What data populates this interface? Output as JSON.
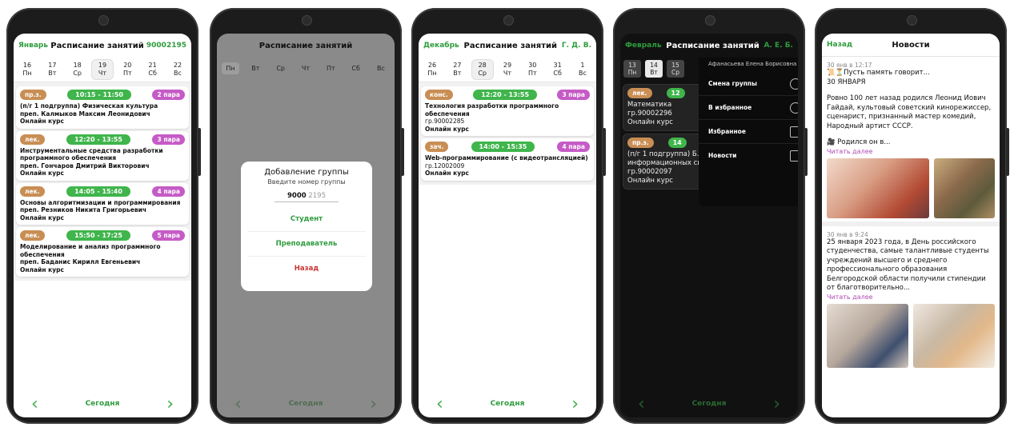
{
  "phone1": {
    "month": "Январь",
    "title": "Расписание занятий",
    "group": "90002195",
    "days": [
      {
        "num": "16",
        "dow": "Пн"
      },
      {
        "num": "17",
        "dow": "Вт"
      },
      {
        "num": "18",
        "dow": "Ср"
      },
      {
        "num": "19",
        "dow": "Чт"
      },
      {
        "num": "20",
        "dow": "Пт"
      },
      {
        "num": "21",
        "dow": "Сб"
      },
      {
        "num": "22",
        "dow": "Вс"
      }
    ],
    "lessons": [
      {
        "type": "пр.з.",
        "time": "10:15 - 11:50",
        "pair": "2 пара",
        "lines": [
          "(п/г 1 подгруппа)  Физическая культура",
          "преп. Калмыков Максим Леонидович",
          "Онлайн курс"
        ]
      },
      {
        "type": "лек.",
        "time": "12:20 - 13:55",
        "pair": "3 пара",
        "lines": [
          "Инструментальные средства разработки программного обеспечения",
          "преп. Гончаров Дмитрий Викторович",
          "Онлайн курс"
        ]
      },
      {
        "type": "лек.",
        "time": "14:05 - 15:40",
        "pair": "4 пара",
        "lines": [
          "Основы алгоритмизации и программирования",
          "преп. Резников Никита Григорьевич",
          "Онлайн курс"
        ]
      },
      {
        "type": "лек.",
        "time": "15:50 - 17:25",
        "pair": "5 пара",
        "lines": [
          "Моделирование и анализ программного обеспечения",
          "преп. Баданис Кирилл Евгеньевич",
          "Онлайн курс"
        ]
      }
    ],
    "today": "Сегодня"
  },
  "phone2": {
    "title": "Расписание занятий",
    "days": [
      "Пн",
      "Вт",
      "Ср",
      "Чт",
      "Пт",
      "Сб",
      "Вс"
    ],
    "dialog": {
      "title": "Добавление группы",
      "subtitle": "Введите номер группы",
      "typed": "9000",
      "hint": "2195",
      "student": "Студент",
      "teacher": "Преподаватель",
      "back": "Назад"
    },
    "today": "Сегодня"
  },
  "phone3": {
    "month": "Декабрь",
    "title": "Расписание занятий",
    "who": "Г. Д. В.",
    "days": [
      {
        "num": "26",
        "dow": "Пн"
      },
      {
        "num": "27",
        "dow": "Вт"
      },
      {
        "num": "28",
        "dow": "Ср"
      },
      {
        "num": "29",
        "dow": "Чт"
      },
      {
        "num": "30",
        "dow": "Пт"
      },
      {
        "num": "31",
        "dow": "Сб"
      },
      {
        "num": "1",
        "dow": "Вс"
      }
    ],
    "lessons": [
      {
        "type": "конс.",
        "time": "12:20 - 13:55",
        "pair": "3 пара",
        "lines": [
          "Технология разработки программного обеспечения",
          "гр.90002285",
          "Онлайн курс"
        ]
      },
      {
        "type": "зач.",
        "time": "14:00 - 15:35",
        "pair": "4 пара",
        "lines": [
          "Web-программирование (с видеотрансляцией)",
          "гр.12002009",
          "Онлайн курс"
        ]
      }
    ],
    "today": "Сегодня"
  },
  "phone4": {
    "month": "Февраль",
    "title": "Расписание занятий",
    "who": "А. Е. Б.",
    "days": [
      {
        "num": "13",
        "dow": "Пн"
      },
      {
        "num": "14",
        "dow": "Вт"
      },
      {
        "num": "15",
        "dow": "Ср"
      }
    ],
    "cards": [
      {
        "type": "лек.",
        "time": "12",
        "lines": [
          "Математика",
          "гр.90002296",
          "Онлайн курс"
        ]
      },
      {
        "type": "пр.з.",
        "time": "14",
        "lines": [
          "(п/г 1 подгруппа) Б...",
          "информационных систем",
          "гр.90002097",
          "Онлайн курс"
        ]
      }
    ],
    "menu": {
      "user": "Афанасьева Елена Борисовна",
      "items": [
        "Смена группы",
        "В избранное",
        "Избранное",
        "Новости"
      ]
    },
    "today": "Сегодня"
  },
  "phone5": {
    "back": "Назад",
    "title": "Новости",
    "items": [
      {
        "meta": "30 янв в 12:17",
        "lines": [
          "📜⏳Пусть память говорит...",
          "30 ЯНВАРЯ",
          "",
          "Ровно 100 лет назад родился Леонид Иович Гайдай, культовый советский кинорежиссер, сценарист, признанный мастер комедий, Народный артист СССР.",
          "",
          "🎥 Родился он в..."
        ],
        "more": "Читать далее"
      },
      {
        "meta": "30 янв в 9:24",
        "lines": [
          "25 января 2023 года, в День российского студенчества, самые талантливые студенты учреждений высшего и среднего профессионального образования Белгородской области получили стипендии от благотворительно..."
        ],
        "more": "Читать далее"
      }
    ]
  },
  "colors": {
    "green": "#3fb54b",
    "brown": "#c88e54",
    "purple": "#c55bc6"
  }
}
